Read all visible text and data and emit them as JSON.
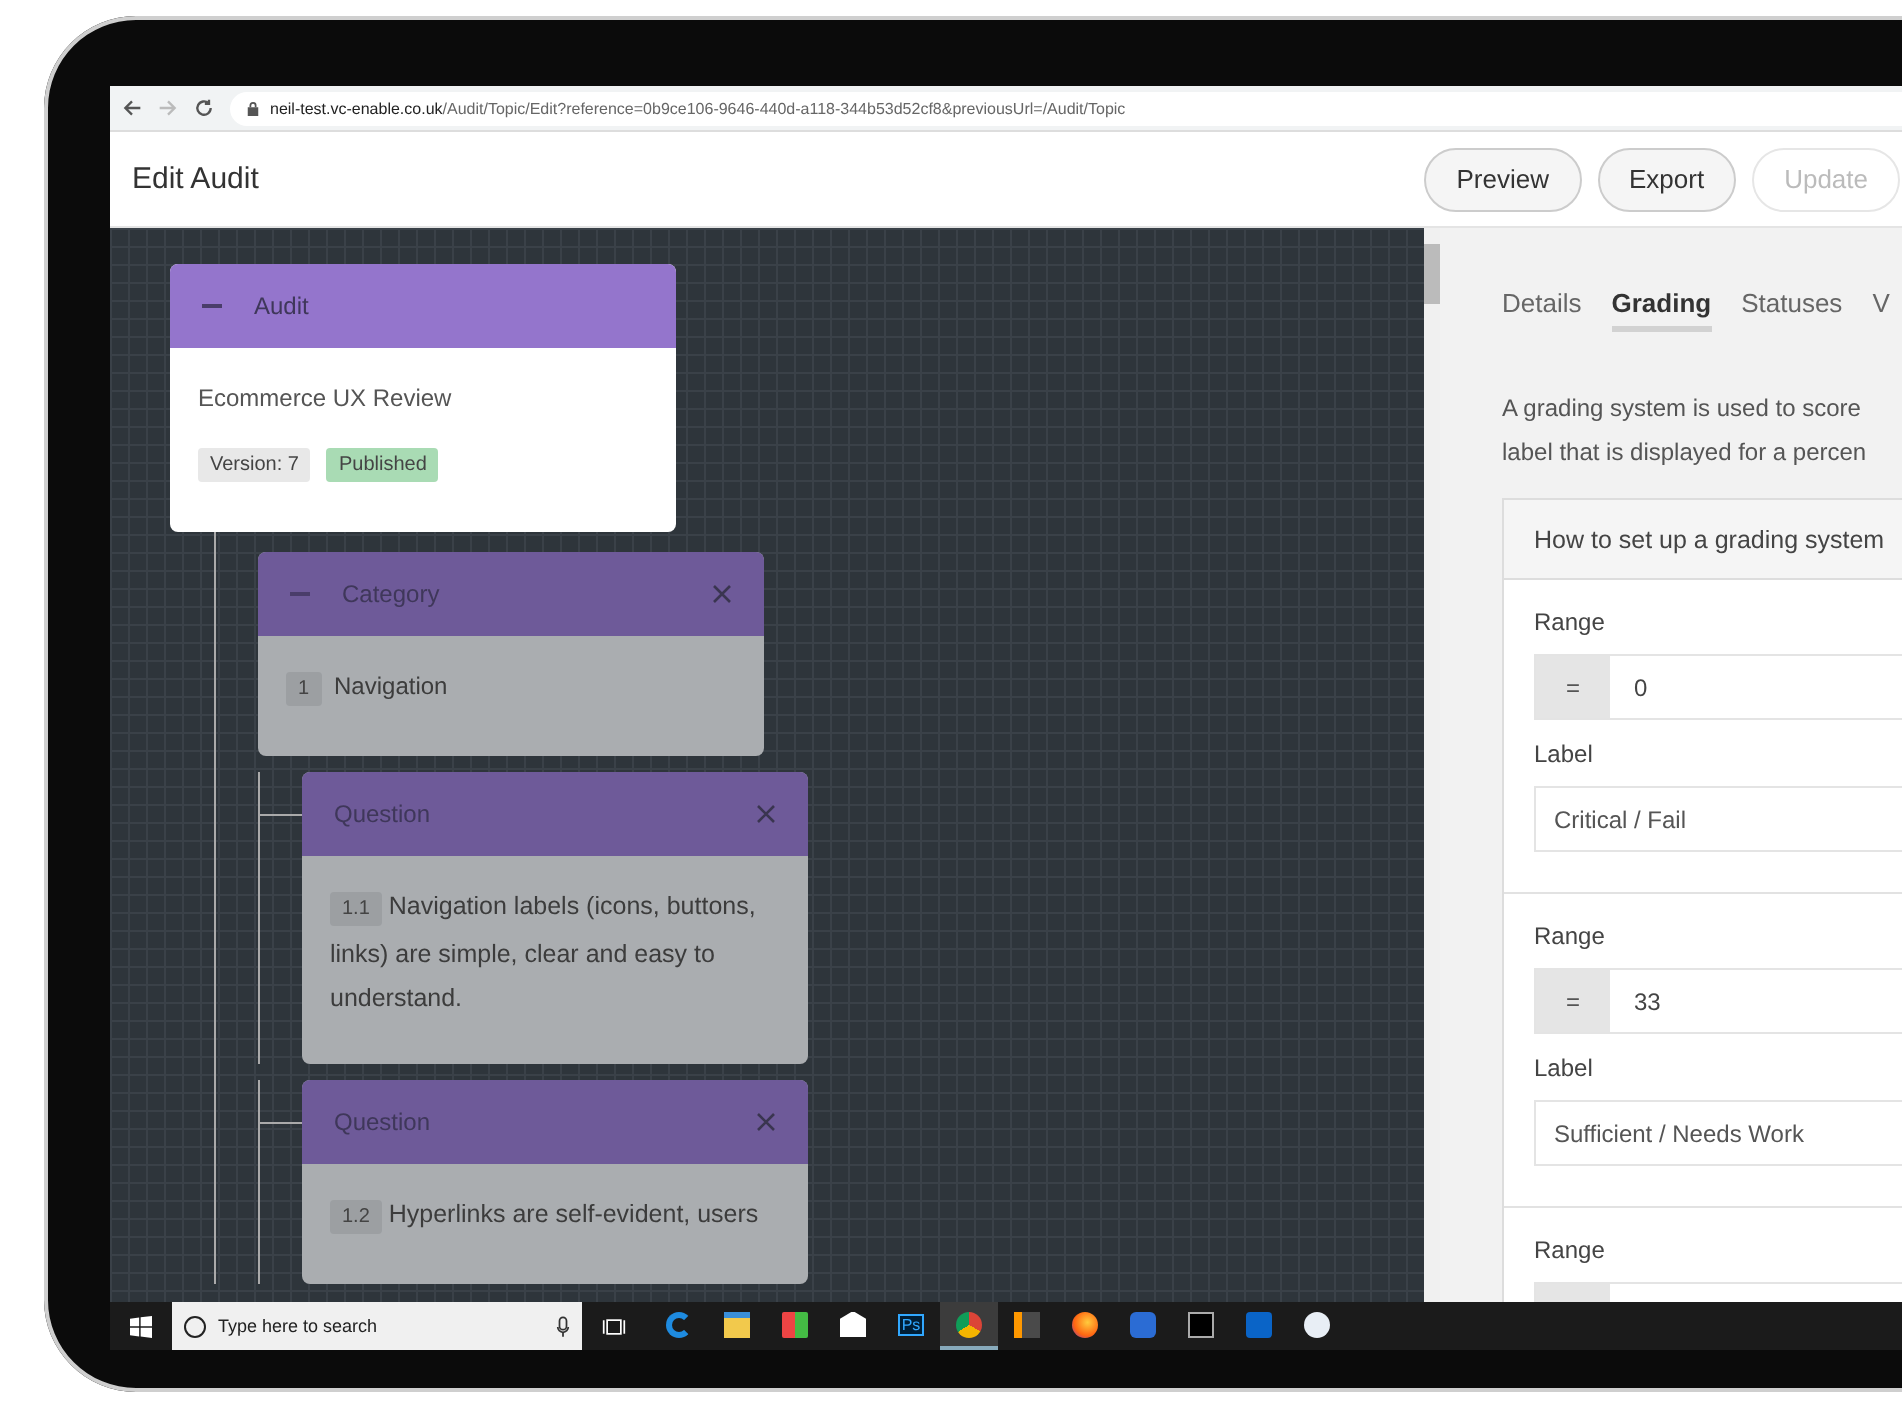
{
  "browser": {
    "url_host": "neil-test.vc-enable.co.uk",
    "url_path": "/Audit/Topic/Edit?reference=0b9ce106-9646-440d-a118-344b53d52cf8&previousUrl=/Audit/Topic"
  },
  "header": {
    "title": "Edit Audit",
    "buttons": [
      {
        "label": "Preview",
        "disabled": false
      },
      {
        "label": "Export",
        "disabled": false
      },
      {
        "label": "Update",
        "disabled": true
      }
    ]
  },
  "tree": {
    "kind": "audit",
    "title": "Audit",
    "name": "Ecommerce UX Review",
    "version": "Version: 7",
    "status": "Published",
    "children": [
      {
        "kind": "category",
        "title": "Category",
        "number": "1",
        "text": "Navigation",
        "children": [
          {
            "kind": "question",
            "title": "Question",
            "number": "1.1",
            "text": "Navigation labels (icons, buttons, links) are simple, clear and easy to understand."
          },
          {
            "kind": "question",
            "title": "Question",
            "number": "1.2",
            "text": "Hyperlinks are self-evident, users"
          }
        ]
      }
    ]
  },
  "panel": {
    "tabs": [
      {
        "label": "Details",
        "selected": false
      },
      {
        "label": "Grading",
        "selected": true
      },
      {
        "label": "Statuses",
        "selected": false
      },
      {
        "label": "V",
        "selected": false
      }
    ],
    "intro": [
      "A grading system is used to score",
      "label that is displayed for a percen"
    ],
    "accordion": "How to set up a grading system",
    "grades": [
      {
        "range_label": "Range",
        "operator": "=",
        "value": "0",
        "label_label": "Label",
        "label": "Critical / Fail"
      },
      {
        "range_label": "Range",
        "operator": "=",
        "value": "33",
        "label_label": "Label",
        "label": "Sufficient / Needs Work"
      },
      {
        "range_label": "Range"
      }
    ]
  },
  "taskbar": {
    "search_placeholder": "Type here to search",
    "apps": [
      {
        "kind": "edge",
        "selected": false
      },
      {
        "kind": "folder",
        "selected": false
      },
      {
        "kind": "store",
        "selected": false
      },
      {
        "kind": "mail",
        "selected": false
      },
      {
        "kind": "photoshop",
        "label": "Ps",
        "selected": false
      },
      {
        "kind": "chrome",
        "selected": true
      },
      {
        "kind": "sublime",
        "selected": false
      },
      {
        "kind": "firefox",
        "selected": false
      },
      {
        "kind": "yammer",
        "selected": false
      },
      {
        "kind": "terminal",
        "selected": false
      },
      {
        "kind": "outlook",
        "selected": false
      },
      {
        "kind": "disc",
        "selected": false
      }
    ]
  }
}
